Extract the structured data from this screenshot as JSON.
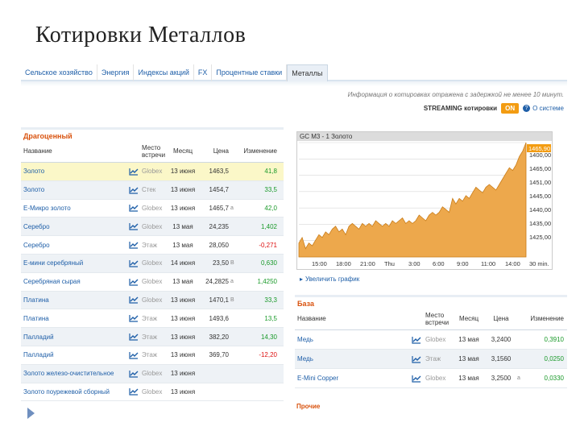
{
  "page_title": "Котировки Металлов",
  "tabs": [
    "Сельское хозяйство",
    "Энергия",
    "Индексы акций",
    "FX",
    "Процентные ставки",
    "Металлы"
  ],
  "active_tab": 5,
  "info_text": "Информация о котировках отражена с задержкой не менее 10 минут.",
  "streaming": {
    "label": "STREAMING котировки",
    "toggle": "ON",
    "about": "О системе"
  },
  "left_table": {
    "section": "Драгоценный",
    "headers": {
      "name": "Название",
      "place": "Место встречи",
      "month": "Месяц",
      "price": "Цена",
      "change": "Изменение"
    },
    "rows": [
      {
        "name": "Золото",
        "place": "Globex",
        "month": "13 июня",
        "price": "1463,5",
        "flag": "",
        "change": "41,8",
        "neg": false
      },
      {
        "name": "Золото",
        "place": "Стек",
        "month": "13 июня",
        "price": "1454,7",
        "flag": "",
        "change": "33,5",
        "neg": false
      },
      {
        "name": "E-Микро золото",
        "place": "Globex",
        "month": "13 июня",
        "price": "1465,7",
        "flag": "а",
        "change": "42,0",
        "neg": false
      },
      {
        "name": "Серебро",
        "place": "Globex",
        "month": "13 мая",
        "price": "24,235",
        "flag": "",
        "change": "1,402",
        "neg": false
      },
      {
        "name": "Серебро",
        "place": "Этаж",
        "month": "13 мая",
        "price": "28,050",
        "flag": "",
        "change": "-0,271",
        "neg": true
      },
      {
        "name": "E-мини серебряный",
        "place": "Globex",
        "month": "14 июня",
        "price": "23,50",
        "flag": "B",
        "change": "0,630",
        "neg": false
      },
      {
        "name": "Серебряная сырая",
        "place": "Globex",
        "month": "13 мая",
        "price": "24,2825",
        "flag": "а",
        "change": "1,4250",
        "neg": false
      },
      {
        "name": "Платина",
        "place": "Globex",
        "month": "13 июня",
        "price": "1470,1",
        "flag": "B",
        "change": "33,3",
        "neg": false
      },
      {
        "name": "Платина",
        "place": "Этаж",
        "month": "13 июня",
        "price": "1493,6",
        "flag": "",
        "change": "13,5",
        "neg": false
      },
      {
        "name": "Палладий",
        "place": "Этаж",
        "month": "13 июня",
        "price": "382,20",
        "flag": "",
        "change": "14,30",
        "neg": false
      },
      {
        "name": "Палладий",
        "place": "Этаж",
        "month": "13 июня",
        "price": "369,70",
        "flag": "",
        "change": "-12,20",
        "neg": true
      },
      {
        "name": "Золото железо-очистительное",
        "place": "Globex",
        "month": "13 июня",
        "price": "",
        "flag": "",
        "change": "",
        "neg": false
      },
      {
        "name": "Золото поурежевой сборный",
        "place": "Globex",
        "month": "13 июня",
        "price": "",
        "flag": "",
        "change": "",
        "neg": false
      }
    ]
  },
  "chart_panel": {
    "header": "GC M3 - 1 Золото",
    "zoom_link": "Увеличить график"
  },
  "chart_data": {
    "type": "area",
    "x_ticks": [
      "15:00",
      "18:00",
      "21:00",
      "Thu",
      "3:00",
      "6:00",
      "9:00",
      "11:00",
      "14:00",
      "30 min."
    ],
    "y_ticks": [
      "1400,00",
      "1465,00",
      "1451,00",
      "1445,00",
      "1440,00",
      "1435,00",
      "1425,00"
    ],
    "current": "1465,90",
    "y_range": [
      1425,
      1466
    ],
    "values": [
      1430,
      1432,
      1428,
      1430,
      1429,
      1431,
      1433,
      1432,
      1434,
      1433,
      1435,
      1436,
      1434,
      1435,
      1433,
      1436,
      1437,
      1436,
      1435,
      1437,
      1436,
      1437,
      1436,
      1438,
      1437,
      1436,
      1437,
      1436,
      1438,
      1437,
      1438,
      1439,
      1437,
      1438,
      1437,
      1438,
      1440,
      1439,
      1438,
      1440,
      1441,
      1440,
      1441,
      1443,
      1442,
      1441,
      1446,
      1444,
      1446,
      1445,
      1447,
      1446,
      1448,
      1450,
      1449,
      1448,
      1450,
      1451,
      1450,
      1449,
      1451,
      1453,
      1455,
      1457,
      1456,
      1458,
      1461,
      1463,
      1466
    ]
  },
  "right_table": {
    "section": "База",
    "headers": {
      "name": "Название",
      "place": "Место встречи",
      "month": "Месяц",
      "price": "Цена",
      "change": "Изменение"
    },
    "rows": [
      {
        "name": "Медь",
        "place": "Globex",
        "month": "13 мая",
        "price": "3,2400",
        "flag": "",
        "change": "0,3910"
      },
      {
        "name": "Медь",
        "place": "Этаж",
        "month": "13 мая",
        "price": "3,1560",
        "flag": "",
        "change": "0,0250"
      },
      {
        "name": "E-Mini Copper",
        "place": "Globex",
        "month": "13 мая",
        "price": "3,2500",
        "flag": "а",
        "change": "0,0330"
      }
    ],
    "next_section": "Прочие"
  },
  "colors": {
    "accent": "#f39c12",
    "link": "#1f5fa8",
    "positive": "#1a9a2a",
    "negative": "#dd1111",
    "area": "#eda84c"
  }
}
